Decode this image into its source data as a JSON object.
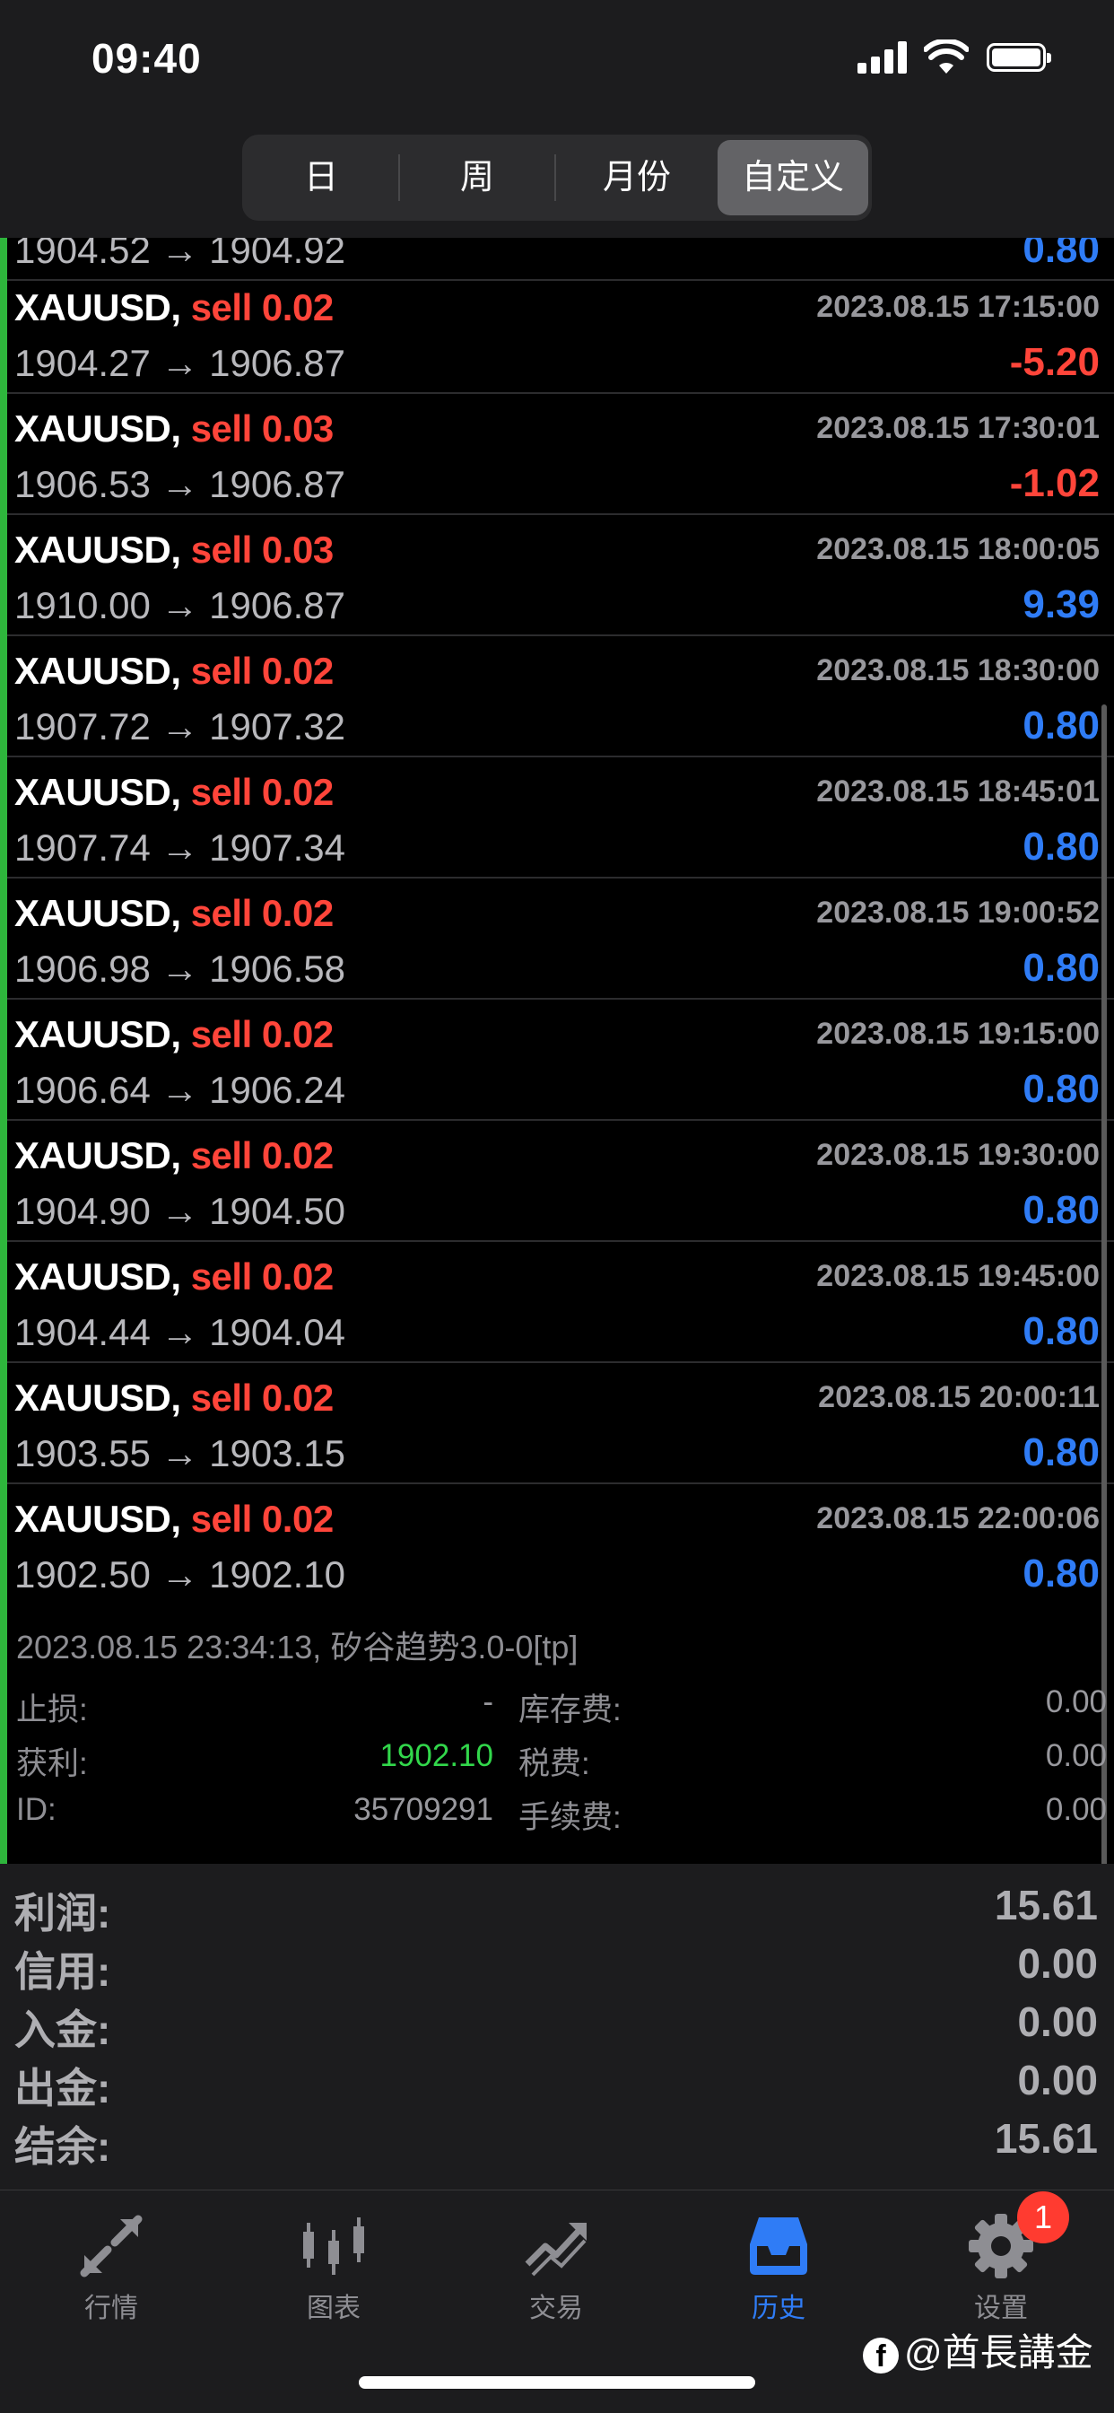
{
  "status_bar": {
    "time": "09:40"
  },
  "period_tabs": [
    {
      "label": "日",
      "active": false
    },
    {
      "label": "周",
      "active": false
    },
    {
      "label": "月份",
      "active": false
    },
    {
      "label": "自定义",
      "active": true
    }
  ],
  "partial_row": {
    "prices": "1904.52 → 1904.92",
    "pl": "0.80"
  },
  "trades": [
    {
      "symbol": "XAUUSD,",
      "direction": "sell 0.02",
      "time": "2023.08.15 17:15:00",
      "prices": "1904.27 → 1906.87",
      "pl": "-5.20"
    },
    {
      "symbol": "XAUUSD,",
      "direction": "sell 0.03",
      "time": "2023.08.15 17:30:01",
      "prices": "1906.53 → 1906.87",
      "pl": "-1.02"
    },
    {
      "symbol": "XAUUSD,",
      "direction": "sell 0.03",
      "time": "2023.08.15 18:00:05",
      "prices": "1910.00 → 1906.87",
      "pl": "9.39"
    },
    {
      "symbol": "XAUUSD,",
      "direction": "sell 0.02",
      "time": "2023.08.15 18:30:00",
      "prices": "1907.72 → 1907.32",
      "pl": "0.80"
    },
    {
      "symbol": "XAUUSD,",
      "direction": "sell 0.02",
      "time": "2023.08.15 18:45:01",
      "prices": "1907.74 → 1907.34",
      "pl": "0.80"
    },
    {
      "symbol": "XAUUSD,",
      "direction": "sell 0.02",
      "time": "2023.08.15 19:00:52",
      "prices": "1906.98 → 1906.58",
      "pl": "0.80"
    },
    {
      "symbol": "XAUUSD,",
      "direction": "sell 0.02",
      "time": "2023.08.15 19:15:00",
      "prices": "1906.64 → 1906.24",
      "pl": "0.80"
    },
    {
      "symbol": "XAUUSD,",
      "direction": "sell 0.02",
      "time": "2023.08.15 19:30:00",
      "prices": "1904.90 → 1904.50",
      "pl": "0.80"
    },
    {
      "symbol": "XAUUSD,",
      "direction": "sell 0.02",
      "time": "2023.08.15 19:45:00",
      "prices": "1904.44 → 1904.04",
      "pl": "0.80"
    },
    {
      "symbol": "XAUUSD,",
      "direction": "sell 0.02",
      "time": "2023.08.15 20:00:11",
      "prices": "1903.55 → 1903.15",
      "pl": "0.80"
    },
    {
      "symbol": "XAUUSD,",
      "direction": "sell 0.02",
      "time": "2023.08.15 22:00:06",
      "prices": "1902.50 → 1902.10",
      "pl": "0.80"
    }
  ],
  "detail": {
    "title": "2023.08.15 23:34:13, 矽谷趋势3.0-0[tp]",
    "stop_loss_label": "止损:",
    "stop_loss_value": "-",
    "take_profit_label": "获利:",
    "take_profit_value": "1902.10",
    "id_label": "ID:",
    "id_value": "35709291",
    "swap_label": "库存费:",
    "swap_value": "0.00",
    "tax_label": "税费:",
    "tax_value": "0.00",
    "commission_label": "手续费:",
    "commission_value": "0.00"
  },
  "summary": [
    {
      "label": "利润:",
      "value": "15.61"
    },
    {
      "label": "信用:",
      "value": "0.00"
    },
    {
      "label": "入金:",
      "value": "0.00"
    },
    {
      "label": "出金:",
      "value": "0.00"
    },
    {
      "label": "结余:",
      "value": "15.61"
    }
  ],
  "tabbar": [
    {
      "label": "行情",
      "icon": "quotes-icon",
      "active": false
    },
    {
      "label": "图表",
      "icon": "chart-icon",
      "active": false
    },
    {
      "label": "交易",
      "icon": "trade-icon",
      "active": false
    },
    {
      "label": "历史",
      "icon": "history-icon",
      "active": true
    },
    {
      "label": "设置",
      "icon": "gear-icon",
      "active": false
    }
  ],
  "settings_badge": "1",
  "watermark": "@酋長講金",
  "colors": {
    "profit": "#2f7cf6",
    "loss": "#ff453a",
    "sell": "#ff453a",
    "active_tab": "#2f7cf6",
    "take_profit": "#32d74b"
  }
}
